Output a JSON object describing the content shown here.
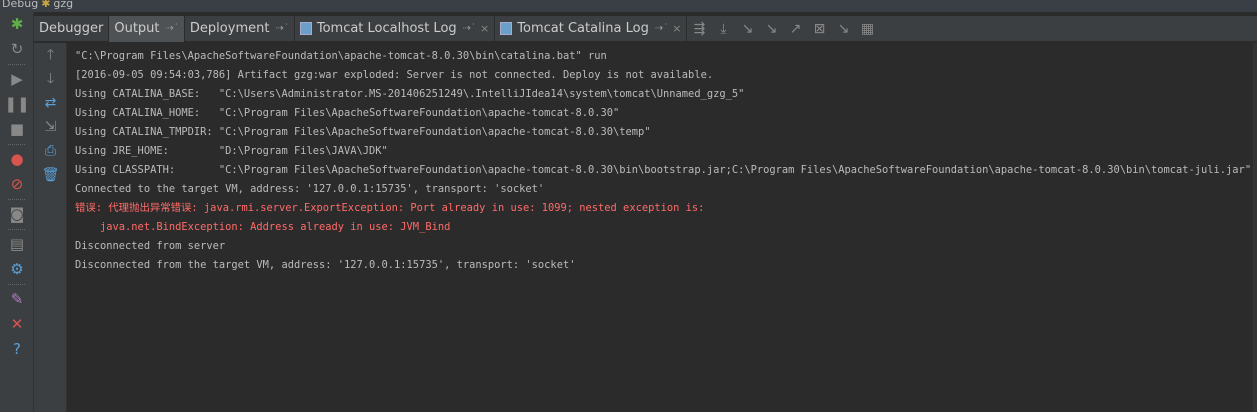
{
  "window": {
    "title": "Debug",
    "config": "gzg"
  },
  "tabs": [
    {
      "label": "Debugger",
      "pinned": false,
      "closable": false
    },
    {
      "label": "Output",
      "pinned": true,
      "closable": false,
      "active": true
    },
    {
      "label": "Deployment",
      "pinned": true,
      "closable": false
    },
    {
      "label": "Tomcat Localhost Log",
      "pinned": true,
      "closable": true
    },
    {
      "label": "Tomcat Catalina Log",
      "pinned": true,
      "closable": true
    }
  ],
  "console": {
    "lines": [
      {
        "text": "\"C:\\Program Files\\ApacheSoftwareFoundation\\apache-tomcat-8.0.30\\bin\\catalina.bat\" run",
        "type": "normal"
      },
      {
        "text": "[2016-09-05 09:54:03,786] Artifact gzg:war exploded: Server is not connected. Deploy is not available.",
        "type": "normal"
      },
      {
        "text": "Using CATALINA_BASE:   \"C:\\Users\\Administrator.MS-201406251249\\.IntelliJIdea14\\system\\tomcat\\Unnamed_gzg_5\"",
        "type": "normal"
      },
      {
        "text": "Using CATALINA_HOME:   \"C:\\Program Files\\ApacheSoftwareFoundation\\apache-tomcat-8.0.30\"",
        "type": "normal"
      },
      {
        "text": "Using CATALINA_TMPDIR: \"C:\\Program Files\\ApacheSoftwareFoundation\\apache-tomcat-8.0.30\\temp\"",
        "type": "normal"
      },
      {
        "text": "Using JRE_HOME:        \"D:\\Program Files\\JAVA\\JDK\"",
        "type": "normal"
      },
      {
        "text": "Using CLASSPATH:       \"C:\\Program Files\\ApacheSoftwareFoundation\\apache-tomcat-8.0.30\\bin\\bootstrap.jar;C:\\Program Files\\ApacheSoftwareFoundation\\apache-tomcat-8.0.30\\bin\\tomcat-juli.jar\"",
        "type": "normal"
      },
      {
        "text": "Connected to the target VM, address: '127.0.0.1:15735', transport: 'socket'",
        "type": "normal"
      },
      {
        "text": "错误: 代理抛出异常错误: java.rmi.server.ExportException: Port already in use: 1099; nested exception is: ",
        "type": "error"
      },
      {
        "text": "    java.net.BindException: Address already in use: JVM_Bind",
        "type": "error"
      },
      {
        "text": "Disconnected from server",
        "type": "normal"
      },
      {
        "text": "Disconnected from the target VM, address: '127.0.0.1:15735', transport: 'socket'",
        "type": "normal"
      }
    ]
  },
  "icons": {
    "pin": "⇢˙",
    "close": "×",
    "bug": "🐞"
  },
  "colors": {
    "error": "#ff6b68",
    "text": "#bbbbbb",
    "background": "#2b2b2b"
  }
}
